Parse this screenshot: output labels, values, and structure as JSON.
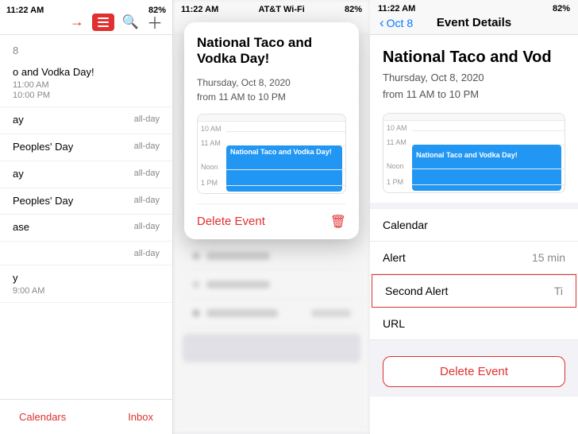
{
  "app": {
    "title": "Calendar"
  },
  "panel1": {
    "status_time": "11:22 AM",
    "battery": "82%",
    "carrier": "AT&T Wi-Fi",
    "date_header": "8",
    "items": [
      {
        "title": "o and Vodka Day!",
        "time1": "11:00 AM",
        "time2": "10:00 PM",
        "badge": ""
      },
      {
        "title": "ay",
        "time1": "",
        "badge": "all-day"
      },
      {
        "title": "Peoples' Day",
        "time1": "",
        "badge": "all-day"
      },
      {
        "title": "ay",
        "time1": "",
        "badge": "all-day"
      },
      {
        "title": "Peoples' Day",
        "time1": "",
        "badge": "all-day"
      },
      {
        "title": "ase",
        "time1": "",
        "badge": "all-day"
      },
      {
        "title": "",
        "time1": "",
        "badge": "all-day"
      },
      {
        "title": "y",
        "time1": "9:00 AM",
        "badge": ""
      }
    ],
    "footer": {
      "calendars_label": "Calendars",
      "inbox_label": "Inbox"
    }
  },
  "panel2": {
    "status_time": "11:22 AM",
    "battery": "82%",
    "carrier": "AT&T Wi-Fi",
    "popup": {
      "title": "National Taco and Vodka Day!",
      "date_line1": "Thursday, Oct 8, 2020",
      "date_line2": "from 11 AM to 10 PM",
      "times": [
        "10 AM",
        "11 AM",
        "Noon",
        "1 PM"
      ],
      "event_label": "National Taco and Vodka Day!",
      "delete_label": "Delete Event"
    }
  },
  "panel3": {
    "status_time": "11:22 AM",
    "battery": "82%",
    "carrier": "AT&T Wi-Fi",
    "back_label": "Oct 8",
    "header_title": "Event Details",
    "event_title": "National Taco and Vod",
    "event_title_truncated": "National Taco and Vodka Day!",
    "date_line1": "Thursday, Oct 8, 2020",
    "date_line2": "from 11 AM to 10 PM",
    "times": [
      "10 AM",
      "11 AM",
      "Noon",
      "1 PM"
    ],
    "event_label": "National Taco and Vodka Day!",
    "rows": [
      {
        "label": "Calendar",
        "value": ""
      },
      {
        "label": "Alert",
        "value": "15 min"
      },
      {
        "label": "Second Alert",
        "value": "Ti"
      },
      {
        "label": "URL",
        "value": ""
      }
    ],
    "delete_label": "Delete Event",
    "colors": {
      "accent": "#007aff",
      "event_blue": "#2196f3",
      "red": "#e03030"
    }
  }
}
